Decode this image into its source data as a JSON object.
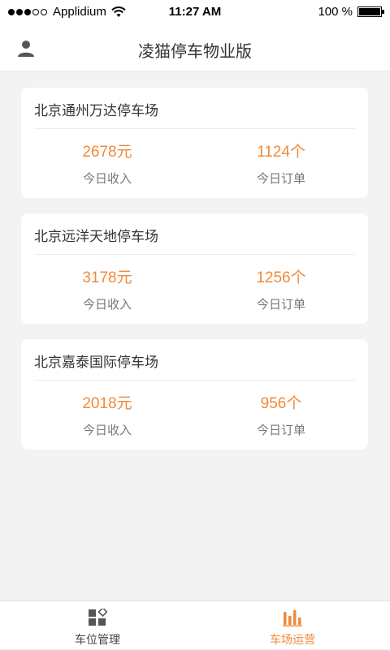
{
  "status_bar": {
    "carrier": "Applidium",
    "time": "11:27 AM",
    "battery": "100 %"
  },
  "header": {
    "title": "凌猫停车物业版",
    "user_icon": "user-icon"
  },
  "parking_lots": [
    {
      "name": "北京通州万达停车场",
      "income": "2678元",
      "income_label": "今日收入",
      "orders": "1124个",
      "orders_label": "今日订单"
    },
    {
      "name": "北京远洋天地停车场",
      "income": "3178元",
      "income_label": "今日收入",
      "orders": "1256个",
      "orders_label": "今日订单"
    },
    {
      "name": "北京嘉泰国际停车场",
      "income": "2018元",
      "income_label": "今日收入",
      "orders": "956个",
      "orders_label": "今日订单"
    }
  ],
  "tabs": [
    {
      "label": "车位管理",
      "icon": "grid-icon",
      "active": false
    },
    {
      "label": "车场运营",
      "icon": "bar-chart-icon",
      "active": true
    }
  ],
  "colors": {
    "accent": "#f08a3a",
    "background": "#f3f3f3",
    "card": "#ffffff"
  }
}
